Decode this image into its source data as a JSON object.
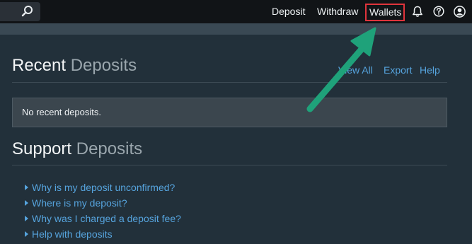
{
  "topbar": {
    "search_icon": "search-icon",
    "nav": {
      "deposit": "Deposit",
      "withdraw": "Withdraw",
      "wallets": "Wallets"
    },
    "icons": [
      "bell-icon",
      "help-icon",
      "account-icon"
    ]
  },
  "recent": {
    "title_main": "Recent",
    "title_light": "Deposits",
    "actions": {
      "view_all": "View All",
      "export": "Export",
      "help": "Help"
    },
    "empty_message": "No recent deposits."
  },
  "support": {
    "title_main": "Support",
    "title_light": "Deposits",
    "links": [
      "Why is my deposit unconfirmed?",
      "Where is my deposit?",
      "Why was I charged a deposit fee?",
      "Help with deposits"
    ]
  },
  "colors": {
    "background": "#22303a",
    "topbar": "#111417",
    "link": "#56a4de",
    "highlight_box": "#e0343c",
    "annotation_arrow": "#1fa27a"
  }
}
